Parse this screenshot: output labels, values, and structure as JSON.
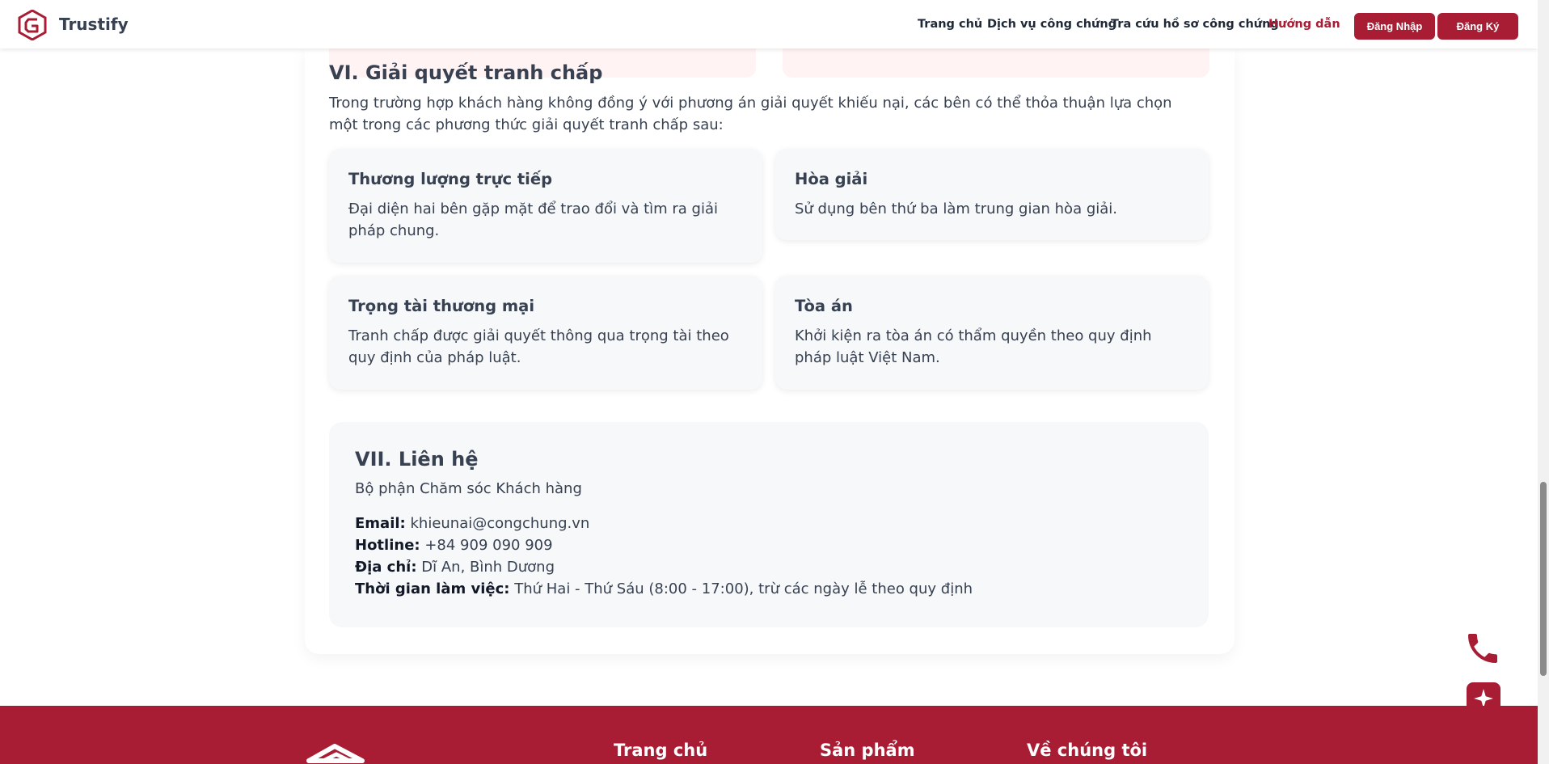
{
  "header": {
    "brand": "Trustify",
    "nav": [
      {
        "label": "Trang chủ"
      },
      {
        "label": "Dịch vụ công chứng"
      },
      {
        "label": "Tra cứu hồ sơ công chứng"
      },
      {
        "label": "Hướng dẫn"
      }
    ],
    "login_label": "Đăng Nhập",
    "register_label": "Đăng Ký"
  },
  "section6": {
    "title": "VI. Giải quyết tranh chấp",
    "intro": "Trong trường hợp khách hàng không đồng ý với phương án giải quyết khiếu nại, các bên có thể thỏa thuận lựa chọn một trong các phương thức giải quyết tranh chấp sau:",
    "cards": [
      {
        "title": "Thương lượng trực tiếp",
        "body": "Đại diện hai bên gặp mặt để trao đổi và tìm ra giải pháp chung."
      },
      {
        "title": "Hòa giải",
        "body": "Sử dụng bên thứ ba làm trung gian hòa giải."
      },
      {
        "title": "Trọng tài thương mại",
        "body": "Tranh chấp được giải quyết thông qua trọng tài theo quy định của pháp luật."
      },
      {
        "title": "Tòa án",
        "body": "Khởi kiện ra tòa án có thẩm quyền theo quy định pháp luật Việt Nam."
      }
    ]
  },
  "section7": {
    "title": "VII. Liên hệ",
    "department": "Bộ phận Chăm sóc Khách hàng",
    "email_label": "Email:",
    "email": "khieunai@congchung.vn",
    "hotline_label": "Hotline:",
    "hotline": "+84 909 090 909",
    "address_label": "Địa chỉ:",
    "address": "Dĩ An, Bình Dương",
    "hours_label": "Thời gian làm việc:",
    "hours": "Thứ Hai - Thứ Sáu (8:00 - 17:00), trừ các ngày lễ theo quy định"
  },
  "footer": {
    "headings": [
      "Trang chủ",
      "Sản phẩm",
      "Về chúng tôi"
    ]
  },
  "colors": {
    "brand": "#a81c34",
    "text": "#374151",
    "card_bg": "#f7f8fa"
  },
  "icons": [
    "trustify-logo-icon",
    "phone-icon",
    "sparkle-icon"
  ]
}
